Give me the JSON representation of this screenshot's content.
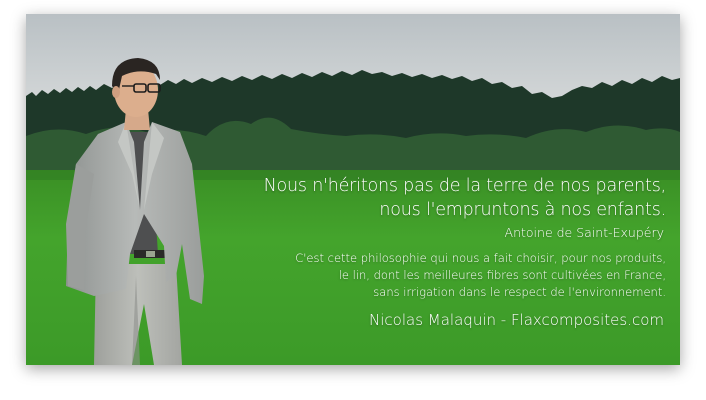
{
  "quote": {
    "lines": [
      "Nous n'héritons pas de la terre de nos parents,",
      "nous l'empruntons à nos enfants."
    ],
    "author": "Antoine de Saint-Exupéry"
  },
  "description": {
    "lines": [
      "C'est cette philosophie qui nous a fait choisir, pour nos produits,",
      "le lin, dont les meilleures fibres sont cultivées en France,",
      "sans irrigation dans le respect de l'environnement."
    ]
  },
  "signature": "Nicolas Malaquin - Flaxcomposites.com",
  "colors": {
    "sky": "#c9ced2",
    "trees": "#1f3a2a",
    "field": "#3f9a2a",
    "suit": "#a8aba9",
    "text": "#ffffff"
  }
}
